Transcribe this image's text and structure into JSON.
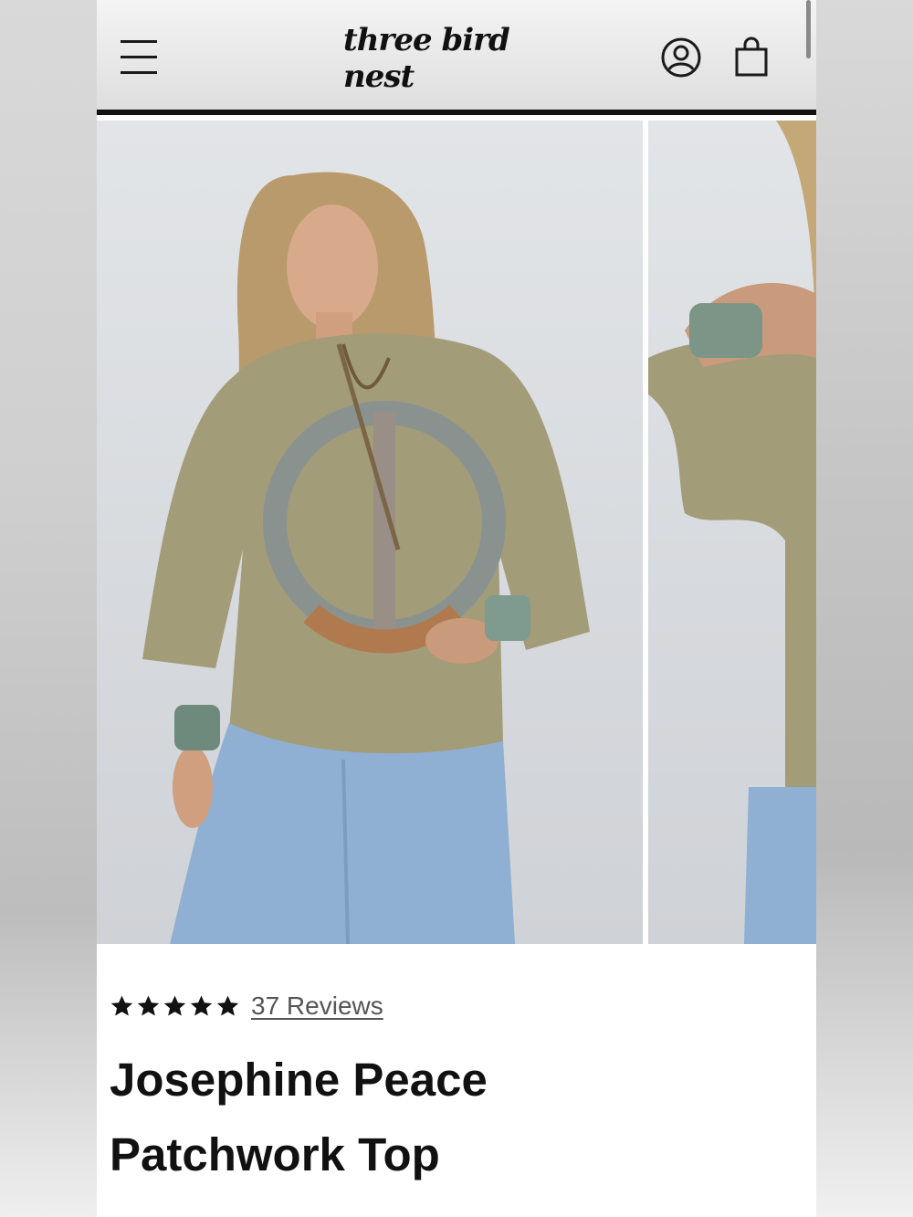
{
  "header": {
    "logo_text": "three bird nest",
    "icons": [
      "menu-icon",
      "account-icon",
      "shopping-bag-icon"
    ]
  },
  "gallery": {
    "images": [
      "product-photo-front",
      "product-photo-detail"
    ]
  },
  "product": {
    "rating_stars": 5,
    "reviews_label": "37 Reviews",
    "title": "Josephine Peace Patchwork Top"
  },
  "colors": {
    "header_border": "#111111",
    "text": "#111111",
    "link": "#555555",
    "shirt": "#a29c78",
    "denim": "#8fb0d3"
  }
}
